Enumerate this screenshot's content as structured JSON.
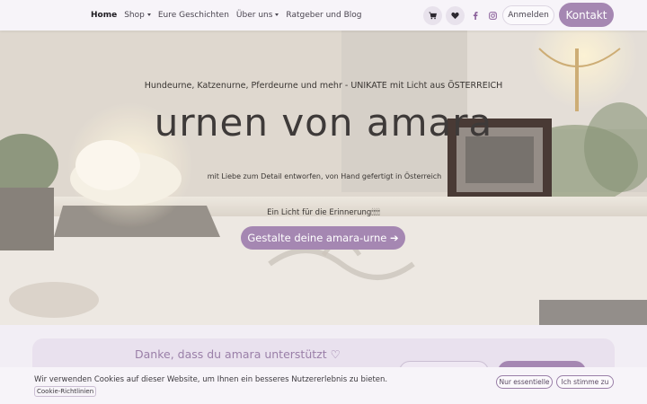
{
  "nav": {
    "items": [
      {
        "label": "Home",
        "active": true,
        "dropdown": false
      },
      {
        "label": "Shop",
        "active": false,
        "dropdown": true
      },
      {
        "label": "Eure Geschichten",
        "active": false,
        "dropdown": false
      },
      {
        "label": "Über uns",
        "active": false,
        "dropdown": true
      },
      {
        "label": "Ratgeber und Blog",
        "active": false,
        "dropdown": false
      }
    ],
    "icons": [
      "cart-icon",
      "heart-icon",
      "facebook-icon",
      "instagram-icon"
    ],
    "login_label": "Anmelden",
    "contact_label": "Kontakt"
  },
  "hero": {
    "tagline": "Hundeurne, Katzenurne, Pferdeurne und mehr - UNIKATE mit Licht aus ÖSTERREICH",
    "title": "urnen von amara",
    "subtitle": "mit Liebe zum Detail entworfen, von Hand gefertigt in Österreich",
    "light_text": "Ein Licht für die Erinnerung🕯🕯🕯🕯",
    "cta_label": "Gestalte deine amara-urne ➔"
  },
  "thanks": {
    "title": "Danke, dass du amara unterstützt ♡"
  },
  "cookie": {
    "text": "Wir verwenden Cookies auf dieser Website, um Ihnen ein besseres Nutzererlebnis zu bieten.",
    "policy_link": "Cookie-Richtlinien",
    "essential_label": "Nur essentielle",
    "accept_label": "Ich stimme zu"
  },
  "colors": {
    "accent": "#a587b2",
    "navbar_bg": "#f7f4f9"
  }
}
